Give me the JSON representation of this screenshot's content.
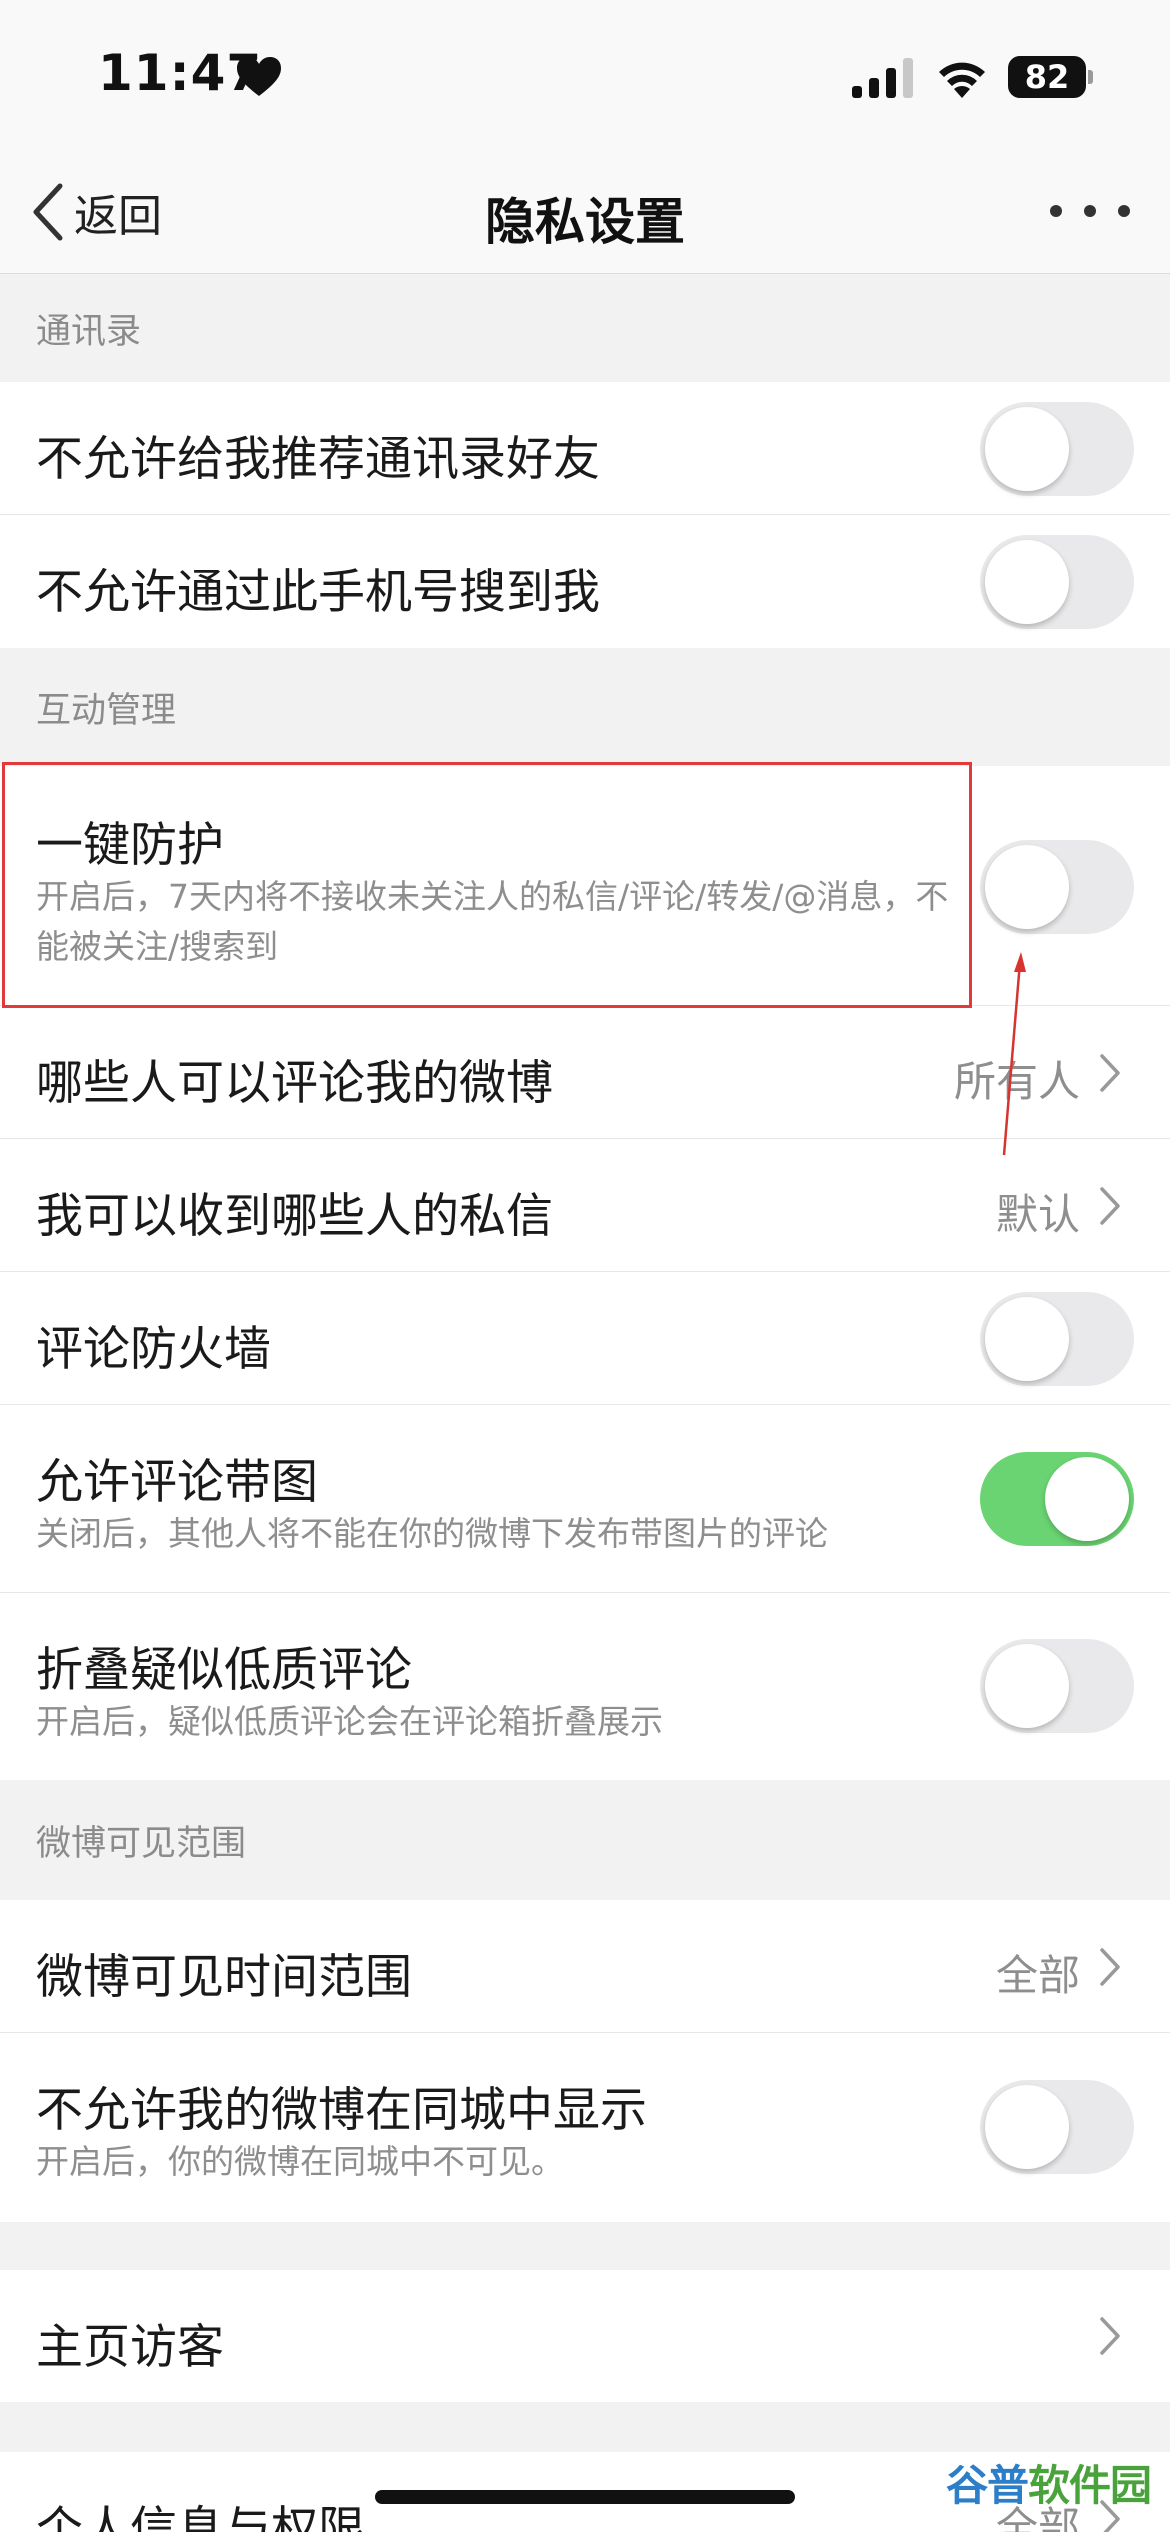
{
  "status_bar": {
    "time": "11:47",
    "battery": "82"
  },
  "nav": {
    "back_label": "返回",
    "title": "隐私设置"
  },
  "sections": {
    "contacts": "通讯录",
    "interaction": "互动管理",
    "visibility": "微博可见范围"
  },
  "rows": {
    "recommend_contacts": {
      "title": "不允许给我推荐通讯录好友",
      "toggle": false
    },
    "search_by_phone": {
      "title": "不允许通过此手机号搜到我",
      "toggle": false
    },
    "one_click_protect": {
      "title": "一键防护",
      "subtitle": "开启后，7天内将不接收未关注人的私信/评论/转发/@消息，不能被关注/搜索到",
      "toggle": false
    },
    "who_can_comment": {
      "title": "哪些人可以评论我的微博",
      "value": "所有人"
    },
    "who_can_message": {
      "title": "我可以收到哪些人的私信",
      "value": "默认"
    },
    "comment_firewall": {
      "title": "评论防火墙",
      "toggle": false
    },
    "allow_comment_images": {
      "title": "允许评论带图",
      "subtitle": "关闭后，其他人将不能在你的微博下发布带图片的评论",
      "toggle": true
    },
    "fold_low_quality": {
      "title": "折叠疑似低质评论",
      "subtitle": "开启后，疑似低质评论会在评论箱折叠展示",
      "toggle": false
    },
    "visible_time_range": {
      "title": "微博可见时间范围",
      "value": "全部"
    },
    "hide_in_local": {
      "title": "不允许我的微博在同城中显示",
      "subtitle": "开启后，你的微博在同城中不可见。",
      "toggle": false
    },
    "homepage_visitors": {
      "title": "主页访客"
    },
    "personal_info": {
      "title": "个人信息与权限",
      "value": "全部"
    }
  },
  "watermark": {
    "part1": "谷普",
    "part2": "软件园"
  },
  "colors": {
    "toggle_on": "#6ad472",
    "toggle_off": "#e9e9eb",
    "highlight": "#e23a3a"
  }
}
